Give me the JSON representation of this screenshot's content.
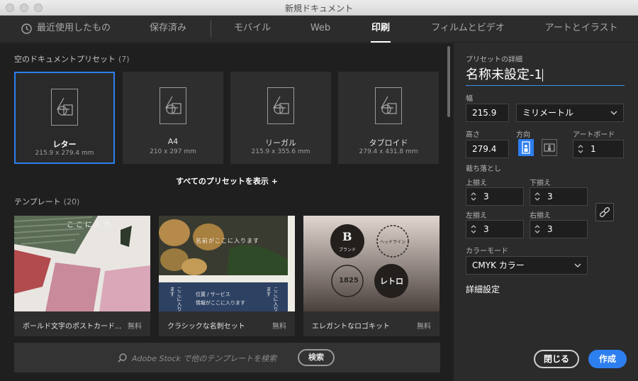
{
  "window": {
    "title": "新規ドキュメント"
  },
  "nav": {
    "tabs": [
      {
        "label": "最近使用したもの",
        "icon": "clock-icon"
      },
      {
        "label": "保存済み"
      },
      {
        "label": "モバイル"
      },
      {
        "label": "Web"
      },
      {
        "label": "印刷",
        "active": true
      },
      {
        "label": "フィルムとビデオ"
      },
      {
        "label": "アートとイラスト"
      }
    ]
  },
  "presets": {
    "header": "空のドキュメントプリセット",
    "count": "(7)",
    "items": [
      {
        "name": "レター",
        "size": "215.9 x 279.4 mm",
        "selected": true
      },
      {
        "name": "A4",
        "size": "210 x 297 mm"
      },
      {
        "name": "リーガル",
        "size": "215.9 x 355.6 mm"
      },
      {
        "name": "タブロイド",
        "size": "279.4 x 431.8 mm"
      }
    ],
    "show_all": "すべてのプリセットを表示 +"
  },
  "templates": {
    "header": "テンプレート",
    "count": "(20)",
    "items": [
      {
        "name": "ボールド文字のポストカード...",
        "price": "無料",
        "thumb_text": [
          "ここに入力"
        ]
      },
      {
        "name": "クラシックな名刺セット",
        "price": "無料",
        "thumb_text": [
          "名前がここに入ります",
          "位置 / サービス",
          "情報がここに入ります",
          "ここに入ります",
          "ここに入ります"
        ]
      },
      {
        "name": "エレガントなロゴキット",
        "price": "無料",
        "thumb_text": [
          "B",
          "ブランド",
          "ヘッドライン",
          "1825",
          "レトロ"
        ]
      }
    ],
    "search_placeholder": "Adobe Stock で他のテンプレートを検索",
    "search_button": "検索"
  },
  "details": {
    "header": "プリセットの詳細",
    "doc_name": "名称未設定-1",
    "width_label": "幅",
    "width_value": "215.9",
    "unit": "ミリメートル",
    "height_label": "高さ",
    "height_value": "279.4",
    "orientation_label": "方向",
    "artboards_label": "アートボード",
    "artboards_value": "1",
    "bleed_label": "裁ち落とし",
    "bleed_top_label": "上揃え",
    "bleed_top": "3",
    "bleed_bottom_label": "下揃え",
    "bleed_bottom": "3",
    "bleed_left_label": "左揃え",
    "bleed_left": "3",
    "bleed_right_label": "右揃え",
    "bleed_right": "3",
    "color_mode_label": "カラーモード",
    "color_mode": "CMYK カラー",
    "advanced": "詳細設定",
    "close_button": "閉じる",
    "create_button": "作成"
  },
  "colors": {
    "accent": "#2d7ff0"
  }
}
